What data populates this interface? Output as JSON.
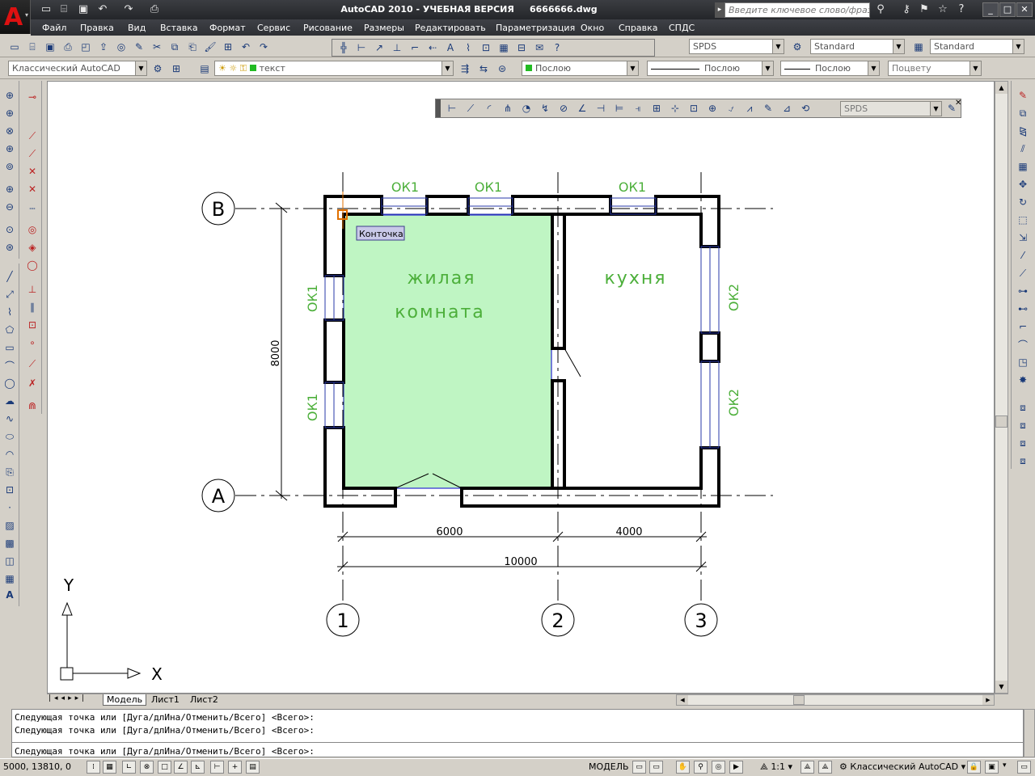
{
  "window": {
    "app_title": "AutoCAD 2010 - УЧЕБНАЯ ВЕРСИЯ     6666666.dwg",
    "search_placeholder": "Введите ключевое слово/фразу",
    "controls": [
      "_",
      "□",
      "✕"
    ]
  },
  "menu": [
    "Файл",
    "Правка",
    "Вид",
    "Вставка",
    "Формат",
    "Сервис",
    "Рисование",
    "Размеры",
    "Редактировать",
    "Параметризация",
    "Окно",
    "Справка",
    "СПДС"
  ],
  "toolbars": {
    "text_style": "SPDS",
    "dim_style": "Standard",
    "table_style": "Standard",
    "workspace": "Классический AutoCAD",
    "layer": "текст",
    "color": "Послою",
    "linetype": "Послою",
    "lineweight": "Послою",
    "plot_style": "Поцвету",
    "dim_toolbar_style": "SPDS"
  },
  "drawing": {
    "axes": {
      "rows": [
        "В",
        "А"
      ],
      "cols": [
        "1",
        "2",
        "3"
      ]
    },
    "rooms": {
      "living_line1": "жилая",
      "living_line2": "комната",
      "kitchen": "кухня"
    },
    "windows": {
      "top": [
        "ОК1",
        "ОК1",
        "ОК1"
      ],
      "left": [
        "ОК1",
        "ОК1"
      ],
      "right": [
        "ОК2",
        "ОК2"
      ]
    },
    "dimensions": {
      "width_1": "6000",
      "width_2": "4000",
      "total": "10000",
      "height": "8000"
    },
    "tooltip": "Конточка",
    "ucs": {
      "x": "X",
      "y": "Y"
    },
    "hatch_color": "#bff5c3",
    "label_color": "#4caf3a"
  },
  "layout_tabs": [
    "Модель",
    "Лист1",
    "Лист2"
  ],
  "command_history": [
    "Следующая точка или [Дуга/длИна/Отменить/Всего] <Всего>:",
    "Следующая точка или [Дуга/длИна/Отменить/Всего] <Всего>:"
  ],
  "command_prompt": "Следующая точка или [Дуга/длИна/Отменить/Всего] <Всего>:",
  "status": {
    "coordinates": "5000, 13810, 0",
    "space": "МОДЕЛЬ",
    "scale": "1:1",
    "workspace": "Классический AutoCAD"
  }
}
